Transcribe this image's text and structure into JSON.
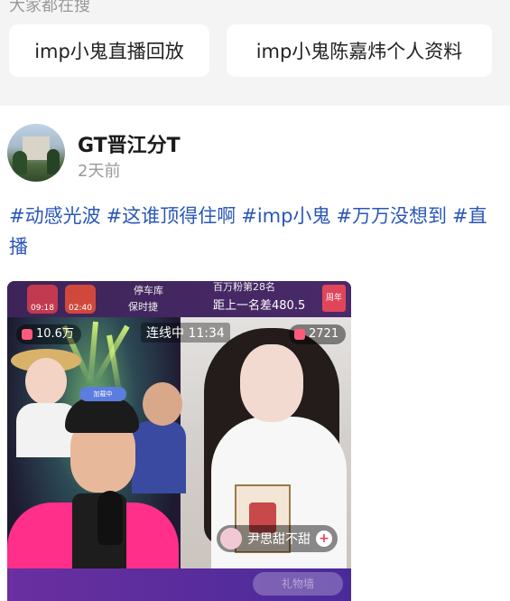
{
  "suggest": {
    "title": "大家都在搜",
    "chips": [
      "imp小鬼直播回放",
      "imp小鬼陈嘉炜个人资料"
    ]
  },
  "post": {
    "author": "GT晋江分T",
    "time": "2天前",
    "hashtags": [
      "#动感光波",
      "#这谁顶得住啊",
      "#imp小鬼",
      "#万万没想到",
      "#直"
    ],
    "caption_continued": "播"
  },
  "video": {
    "top_left_times": [
      "09:18",
      "02:40"
    ],
    "garage_label": "停车库",
    "time_label": "保时捷",
    "rank_label": "百万粉第28名",
    "gap_label": "距上一名差480.5",
    "badge": "周年庆",
    "left_count": "10.6万",
    "connecting": "连线中 11:34",
    "right_count": "2721",
    "hairband_text": "加载中",
    "guest_name": "尹思甜不甜",
    "bottom_tag": "礼物墙"
  },
  "colors": {
    "hashtag": "#2a57b8",
    "accent": "#e0455a",
    "host_jacket": "#ff2f8a"
  }
}
